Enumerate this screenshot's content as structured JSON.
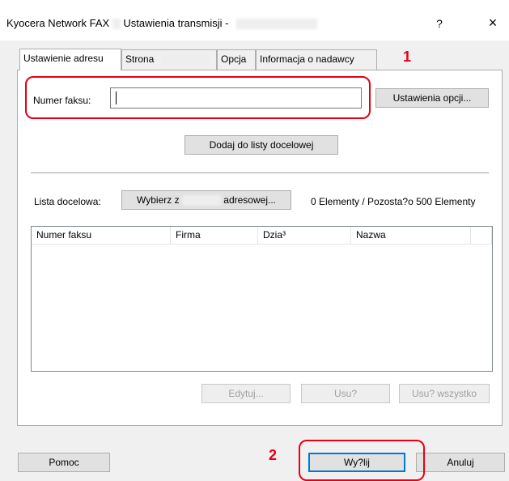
{
  "window": {
    "title_app": "Kyocera Network FAX",
    "title_settings": "Ustawienia transmisji -",
    "help_btn": "?",
    "close_btn": "×"
  },
  "tabs": [
    {
      "label": "Ustawienie adresu"
    },
    {
      "label": "Strona"
    },
    {
      "label": "Opcja"
    },
    {
      "label": "Informacja o nadawcy"
    }
  ],
  "fax": {
    "label": "Numer faksu:",
    "value": "",
    "options_button": "Ustawienia opcji..."
  },
  "add_button": "Dodaj do listy docelowej",
  "destination": {
    "label": "Lista docelowa:",
    "select_prefix": "Wybierz z",
    "select_suffix": "adresowej...",
    "count": "0 Elementy / Pozosta?o 500 Elementy"
  },
  "columns": [
    "Numer faksu",
    "Firma",
    "Dzia³",
    "Nazwa"
  ],
  "list_buttons": {
    "edit": "Edytuj...",
    "delete": "Usu?",
    "delete_all": "Usu? wszystko"
  },
  "footer": {
    "help": "Pomoc",
    "send": "Wy?lij",
    "cancel": "Anuluj"
  },
  "annotations": {
    "marker1": "1",
    "marker2": "2",
    "color": "#e60012"
  }
}
